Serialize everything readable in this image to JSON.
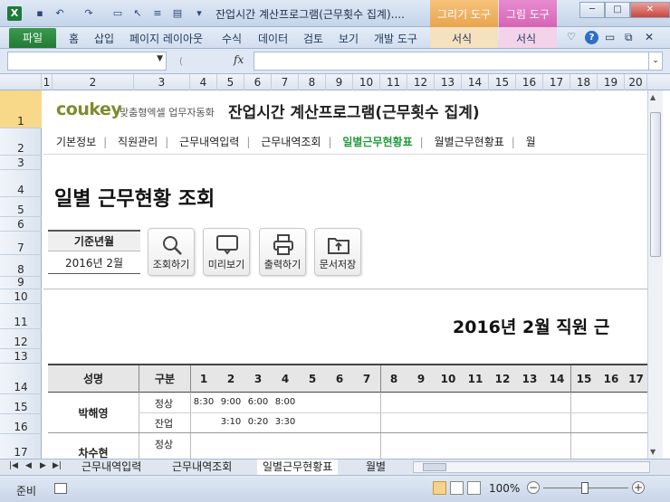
{
  "window": {
    "title": "잔업시간 계산프로그램(근무횟수 집계)....",
    "context_tabs": {
      "draw": "그리기 도구",
      "picture": "그림 도구"
    },
    "controls": {
      "minimize": "─",
      "restore": "□",
      "close": "✕"
    }
  },
  "ribbon": {
    "file": "파일",
    "tabs": [
      "홈",
      "삽입",
      "페이지 레이아웃",
      "수식",
      "데이터",
      "검토",
      "보기",
      "개발 도구"
    ],
    "context_sub": {
      "draw": "서식",
      "picture": "서식"
    }
  },
  "formula_bar": {
    "name_box": "",
    "fx_label": "fx",
    "formula": ""
  },
  "columns": [
    "1",
    "2",
    "3",
    "4",
    "5",
    "6",
    "7",
    "8",
    "9",
    "10",
    "11",
    "12",
    "13",
    "14",
    "15",
    "16",
    "17",
    "18",
    "19",
    "20"
  ],
  "rows": [
    "1",
    "2",
    "3",
    "4",
    "5",
    "6",
    "7",
    "8",
    "9",
    "10",
    "11",
    "12",
    "13",
    "14",
    "15",
    "16",
    "17"
  ],
  "content": {
    "logo": "coukey",
    "logo_sub": "맞춤형엑셀 업무자동화",
    "program_title": "잔업시간 계산프로그램(근무횟수 집계)",
    "nav": [
      "기본정보",
      "직원관리",
      "근무내역입력",
      "근무내역조회",
      "일별근무현황표",
      "월별근무현황표",
      "월"
    ],
    "page_heading": "일별 근무현황 조회",
    "base_label": "기준년월",
    "base_value": "2016년  2월",
    "buttons": [
      "조회하기",
      "미리보기",
      "출력하기",
      "문서저장"
    ],
    "report_title": "2016년 2월 직원 근"
  },
  "table": {
    "header_name": "성명",
    "header_cat": "구분",
    "days": [
      "1",
      "2",
      "3",
      "4",
      "5",
      "6",
      "7",
      "8",
      "9",
      "10",
      "11",
      "12",
      "13",
      "14",
      "15",
      "16",
      "17"
    ],
    "employees": [
      {
        "name": "박해영",
        "rows": [
          {
            "cat": "정상",
            "values": [
              "8:30",
              "9:00",
              "6:00",
              "8:00"
            ]
          },
          {
            "cat": "잔업",
            "values": [
              "",
              "3:10",
              "0:20",
              "3:30"
            ]
          }
        ]
      },
      {
        "name": "차수현",
        "rows": [
          {
            "cat": "정상",
            "values": []
          }
        ]
      }
    ]
  },
  "sheet_tabs": [
    "근무내역입력",
    "근무내역조회",
    "일별근무현황표",
    "월별"
  ],
  "status": {
    "ready": "준비",
    "zoom": "100%",
    "minus": "−",
    "plus": "+"
  }
}
